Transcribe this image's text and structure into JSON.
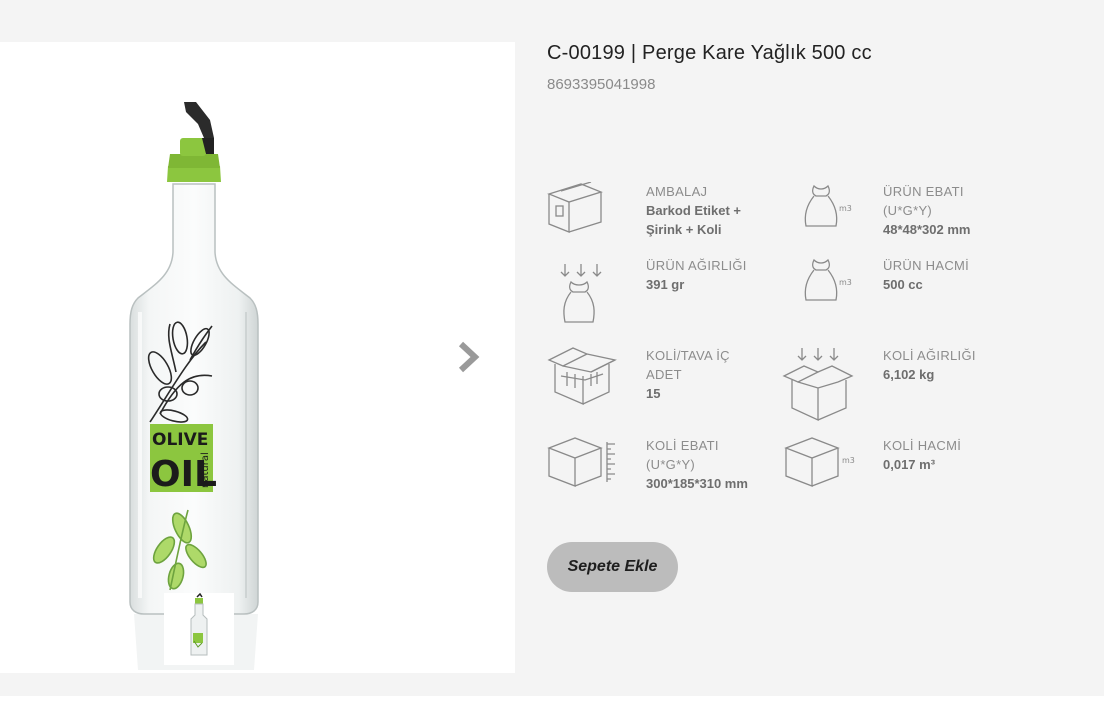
{
  "product": {
    "title": "C-00199 | Perge Kare Yağlık 500 cc",
    "barcode": "8693395041998",
    "image_label": {
      "line1": "OLIVE",
      "line2": "OIL",
      "line3": "natural"
    }
  },
  "specs": [
    {
      "icon": "box-icon",
      "label": "AMBALAJ",
      "value": "Barkod Etiket + Şirink + Koli"
    },
    {
      "icon": "sack-m3-icon",
      "label": "ÜRÜN EBATI (U*G*Y)",
      "value": "48*48*302 mm",
      "icon_text": "m3"
    },
    {
      "icon": "sack-weight-icon",
      "label": "ÜRÜN AĞIRLIĞI",
      "value": "391 gr"
    },
    {
      "icon": "sack-volume-icon",
      "label": "ÜRÜN HACMİ",
      "value": "500 cc",
      "icon_text": "m3"
    },
    {
      "icon": "open-box-grid-icon",
      "label": "KOLİ/TAVA İÇ ADET",
      "value": "15"
    },
    {
      "icon": "open-box-weight-icon",
      "label": "KOLİ AĞIRLIĞI",
      "value": "6,102 kg"
    },
    {
      "icon": "box-ruler-icon",
      "label": "KOLİ EBATI (U*G*Y)",
      "value": "300*185*310 mm"
    },
    {
      "icon": "box-volume-icon",
      "label": "KOLİ HACMİ",
      "value": "0,017 m³",
      "icon_text": "m3"
    }
  ],
  "actions": {
    "add_to_cart": "Sepete Ekle"
  },
  "colors": {
    "accent_green": "#8cc63f",
    "button_bg": "#bcbcbc",
    "page_bg": "#f4f4f4"
  }
}
